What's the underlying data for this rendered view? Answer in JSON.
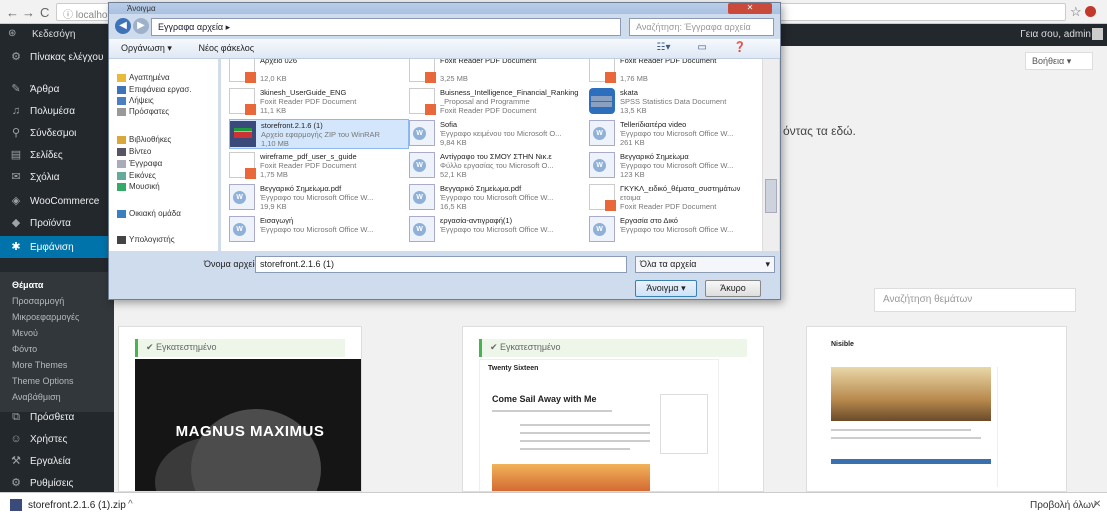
{
  "browser": {
    "back": "←",
    "forward": "→",
    "reload": "C",
    "address": "ⓘ localhost/wordpress/wp-admin/theme-install.php",
    "star": "☆"
  },
  "adminbar": {
    "site": "Κεδεσόγη",
    "howdy": "Γεια σου, admin"
  },
  "sidebar": {
    "items": [
      {
        "label": "Πίνακας ελέγχου",
        "icon": "dashboard-icon"
      },
      {
        "label": "Άρθρα",
        "icon": "pin-icon"
      },
      {
        "label": "Πολυμέσα",
        "icon": "media-icon"
      },
      {
        "label": "Σύνδεσμοι",
        "icon": "link-icon"
      },
      {
        "label": "Σελίδες",
        "icon": "page-icon"
      },
      {
        "label": "Σχόλια",
        "icon": "comment-icon"
      },
      {
        "label": "WooCommerce",
        "icon": "woo-icon"
      },
      {
        "label": "Προϊόντα",
        "icon": "product-icon"
      },
      {
        "label": "Εμφάνιση",
        "icon": "appearance-icon"
      },
      {
        "label": "Πρόσθετα",
        "icon": "plugin-icon"
      },
      {
        "label": "Χρήστες",
        "icon": "users-icon"
      },
      {
        "label": "Εργαλεία",
        "icon": "tools-icon"
      },
      {
        "label": "Ρυθμίσεις",
        "icon": "settings-icon"
      }
    ],
    "submenu": [
      "Θέματα",
      "Προσαρμογή",
      "Μικροεφαρμογές",
      "Μενού",
      "Φόντο",
      "More Themes",
      "Theme Options",
      "Αναβάθμιση"
    ]
  },
  "main": {
    "help": "Βοήθεια ▾",
    "bg_text": "όντας τα εδώ.",
    "search_placeholder": "Αναζήτηση θεμάτων",
    "installed_label": "✔ Εγκατεστημένο",
    "card1_title": "MAGNUS MAXIMUS",
    "card2_title": "Come Sail Away with Me",
    "card2_site": "Twenty Sixteen",
    "card3_site": "Nisible"
  },
  "dialog": {
    "title": "Άνοιγμα",
    "address": "Εγγραφα αρχεία ▸",
    "search": "Αναζήτηση: Έγγραφα αρχεία",
    "organize": "Οργάνωση ▾",
    "new_folder": "Νέος φάκελος",
    "tree": [
      {
        "label": "Αγαπημένα",
        "icon": "star-icon",
        "color": "#e8b93a"
      },
      {
        "label": "Επιφάνεια εργασ.",
        "icon": "desktop-icon",
        "color": "#3e73b8"
      },
      {
        "label": "Λήψεις",
        "icon": "download-icon",
        "color": "#4a7fc0"
      },
      {
        "label": "Πρόσφατες",
        "icon": "recent-icon",
        "color": "#999"
      },
      {
        "label": "Βιβλιοθήκες",
        "icon": "library-icon",
        "color": "#d9a73a"
      },
      {
        "label": "Βίντεο",
        "icon": "video-icon",
        "color": "#556"
      },
      {
        "label": "Έγγραφα",
        "icon": "documents-icon",
        "color": "#aab"
      },
      {
        "label": "Εικόνες",
        "icon": "pictures-icon",
        "color": "#6a9"
      },
      {
        "label": "Μουσική",
        "icon": "music-icon",
        "color": "#3a6"
      },
      {
        "label": "Οικιακή ομάδα",
        "icon": "homegroup-icon",
        "color": "#3a7fc0"
      },
      {
        "label": "Υπολογιστής",
        "icon": "computer-icon",
        "color": "#444"
      }
    ],
    "files": [
      {
        "name": "Αρχείο 026",
        "type": "",
        "size": "12,0 KB",
        "kind": "pdf"
      },
      {
        "name": "Foxit Reader PDF Document",
        "type": "",
        "size": "3,25 MB",
        "kind": "pdf"
      },
      {
        "name": "Foxit Reader PDF Document",
        "type": "",
        "size": "1,76 MB",
        "kind": "pdf"
      },
      {
        "name": "3kinesh_UserGuide_ENG",
        "type": "Foxit Reader PDF Document",
        "size": "11,1 KB",
        "kind": "pdf"
      },
      {
        "name": "Buisness_Intelligence_Financial_Ranking",
        "type": "_Proposal and Programme",
        "size": "Foxit Reader PDF Document",
        "kind": "pdf"
      },
      {
        "name": "skata",
        "type": "SPSS Statistics Data Document",
        "size": "13,5 KB",
        "kind": "sps"
      },
      {
        "name": "storefront.2.1.6 (1)",
        "type": "Αρχείο εφαρμογής ZIP του WinRAR",
        "size": "1,10 MB",
        "kind": "exe"
      },
      {
        "name": "Sofia",
        "type": "Έγγραφο κειμένου του Microsoft O...",
        "size": "9,84 KB",
        "kind": "doc"
      },
      {
        "name": "Tellerίδιαιτέρα video",
        "type": "Έγγραφο του Microsoft Office W...",
        "size": "261 KB",
        "kind": "doc"
      },
      {
        "name": "wireframe_pdf_user_s_guide",
        "type": "Foxit Reader PDF Document",
        "size": "1,75 MB",
        "kind": "pdf"
      },
      {
        "name": "Αντίγραφο του ΣΜΟΥ ΣΤΗΝ Νικ.ε",
        "type": "Φύλλο εργασίας του Microsoft O...",
        "size": "52,1 KB",
        "kind": "doc"
      },
      {
        "name": "Βεγγαρικό Σημείωμα",
        "type": "Έγγραφο του Microsoft Office W...",
        "size": "123 KB",
        "kind": "doc"
      },
      {
        "name": "Βεγγαρικό Σημείωμα.pdf",
        "type": "Έγγραφο του Microsoft Office W...",
        "size": "19,9 KB",
        "kind": "doc"
      },
      {
        "name": "Βεγγαρικό Σημείωμα.pdf",
        "type": "Έγγραφο του Microsoft Office W...",
        "size": "16,5 KB",
        "kind": "doc"
      },
      {
        "name": "ΓΚΥΚΛ_ειδικό_θέματα_συστημάτων",
        "type": "ετοιμα",
        "size": "Foxit Reader PDF Document",
        "kind": "pdf"
      },
      {
        "name": "Εισαγωγή",
        "type": "Έγγραφο του Microsoft Office W...",
        "size": "",
        "kind": "doc"
      },
      {
        "name": "εργασία-αντιγραφή(1)",
        "type": "Έγγραφο του Microsoft Office W...",
        "size": "",
        "kind": "doc"
      },
      {
        "name": "Εργασία στο Δικό",
        "type": "Έγγραφο του Microsoft Office W...",
        "size": "",
        "kind": "doc"
      }
    ],
    "filename_label": "Όνομα αρχείου:",
    "filename_value": "storefront.2.1.6 (1)",
    "filetype": "Όλα τα αρχεία",
    "open": "Άνοιγμα",
    "cancel": "Άκυρο"
  },
  "download": {
    "file": "storefront.2.1.6 (1).zip",
    "show_all": "Προβολή όλων"
  },
  "colors": {
    "sidebar": "#23282d",
    "accent": "#0073aa",
    "installed": "#46b450"
  }
}
